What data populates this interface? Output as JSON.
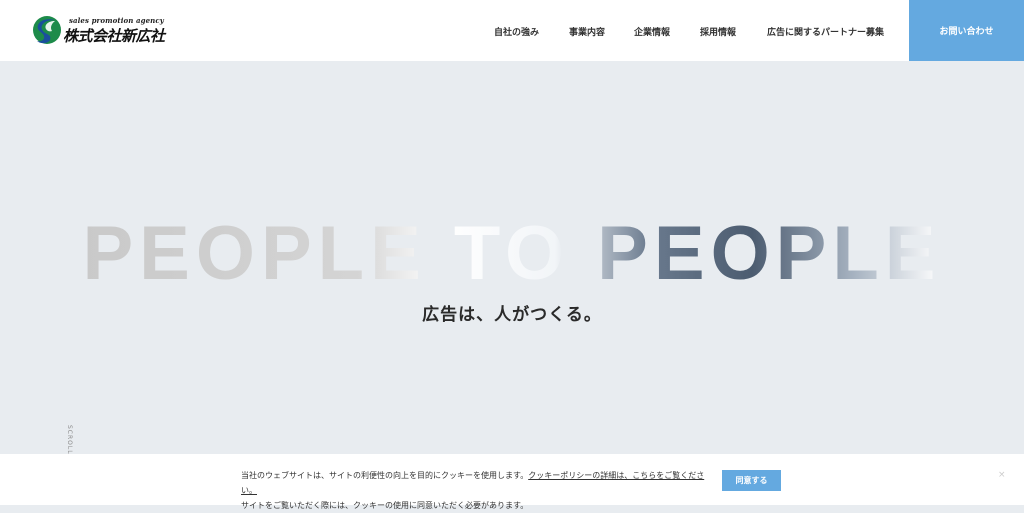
{
  "header": {
    "logo": {
      "tagline": "sales promotion agency",
      "company_name": "株式会社新広社"
    },
    "nav": [
      {
        "label": "自社の強み"
      },
      {
        "label": "事業内容"
      },
      {
        "label": "企業情報"
      },
      {
        "label": "採用情報"
      },
      {
        "label": "広告に関するパートナー募集"
      }
    ],
    "contact_label": "お問い合わせ"
  },
  "hero": {
    "title": "PEOPLE TO PEOPLE",
    "tagline": "広告は、人がつくる。",
    "scroll_label": "SCROLL"
  },
  "cookie": {
    "line1": "当社のウェブサイトは、サイトの利便性の向上を目的にクッキーを使用します。",
    "policy_link": "クッキーポリシーの詳細は、こちらをご覧ください。",
    "line2": "サイトをご覧いただく際には、クッキーの使用に同意いただく必要があります。",
    "agree_label": "同意する",
    "close_label": "×"
  },
  "colors": {
    "accent": "#64a9e0",
    "hero_bg": "#e8ecf0"
  }
}
